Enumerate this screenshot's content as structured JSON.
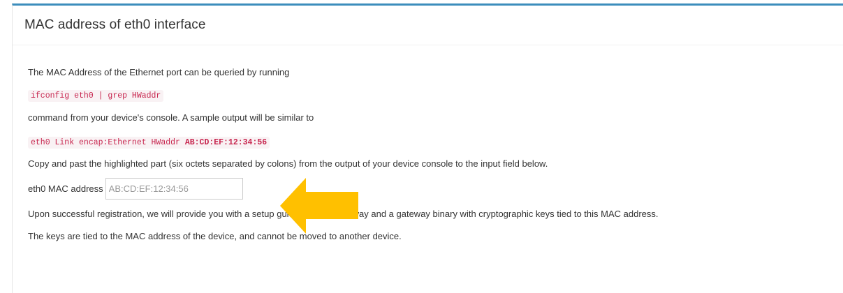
{
  "panel": {
    "title": "MAC address of eth0 interface"
  },
  "instructions": {
    "intro": "The MAC Address of the Ethernet port can be queried by running",
    "command": "ifconfig eth0 | grep HWaddr",
    "after_command": "command from your device's console. A sample output will be similar to",
    "sample_output_prefix": "eth0 Link encap:Ethernet HWaddr ",
    "sample_output_highlight": "AB:CD:EF:12:34:56",
    "copy_instruction": "Copy and past the highlighted part (six octets separated by colons) from the output of your device console to the input field below.",
    "registration_note": "Upon successful registration, we will provide you with a setup guide for your gateway and a gateway binary with cryptographic keys tied to this MAC address.",
    "keys_note": "The keys are tied to the MAC address of the device, and cannot be moved to another device."
  },
  "form": {
    "mac_label": "eth0 MAC address",
    "mac_placeholder": "AB:CD:EF:12:34:56",
    "mac_value": ""
  },
  "colors": {
    "accent_border": "#3c8dbc",
    "code_text": "#c7254e",
    "code_background": "#f9f2f4",
    "arrow": "#ffc000"
  },
  "icons": {
    "arrow": "left-pointing-arrow-icon"
  }
}
